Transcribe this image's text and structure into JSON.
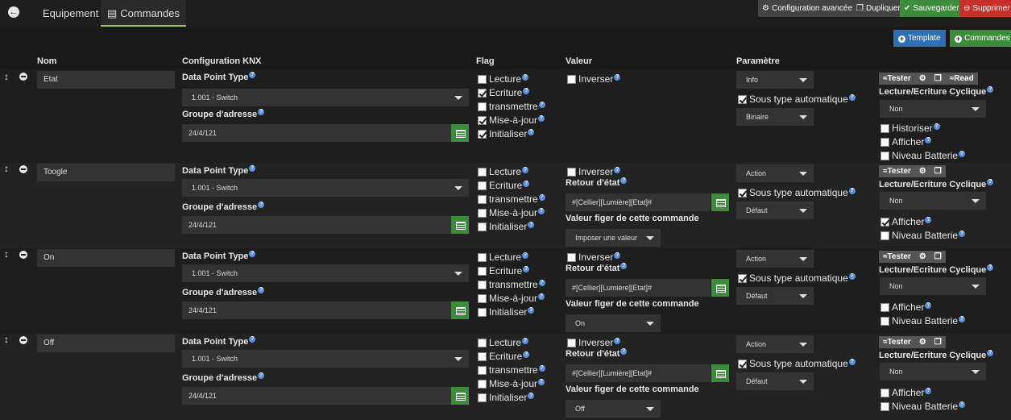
{
  "tabs": {
    "equipement": "Equipement",
    "commandes": "Commandes"
  },
  "toolbar": {
    "config": "Configuration avancée",
    "dupliquer": "Dupliquer",
    "sauvegarder": "Sauvegarder",
    "supprimer": "Supprimer"
  },
  "actions": {
    "template": "Template",
    "commandes": "Commandes"
  },
  "headers": {
    "nom": "Nom",
    "config": "Configuration KNX",
    "flag": "Flag",
    "valeur": "Valeur",
    "parametre": "Paramètre"
  },
  "labels": {
    "dpt": "Data Point Type",
    "groupe": "Groupe d'adresse",
    "lecture": "Lecture",
    "ecriture": "Ecriture",
    "transmettre": "transmettre",
    "miseajour": "Mise-à-jour",
    "initialiser": "Initialiser",
    "inverser": "Inverser",
    "retour": "Retour d'état",
    "figer": "Valeur figer de cette commande",
    "soustype": "Sous type automatique",
    "cyclique": "Lecture/Ecriture Cyclique",
    "historiser": "Historiser",
    "afficher": "Afficher",
    "batterie": "Niveau Batterie",
    "tester": "Tester",
    "read": "Read"
  },
  "rows": [
    {
      "name": "Etat",
      "dpt": "1.001 - Switch",
      "groupe": "24/4/121",
      "type": "Info",
      "subtype": "Binaire",
      "cyclique": "Non"
    },
    {
      "name": "Toogle",
      "dpt": "1.001 - Switch",
      "groupe": "24/4/121",
      "retour": "#[Cellier][Lumière][Etat]#",
      "figer": "Imposer une valeur",
      "type": "Action",
      "subtype": "Défaut",
      "cyclique": "Non"
    },
    {
      "name": "On",
      "dpt": "1.001 - Switch",
      "groupe": "24/4/121",
      "retour": "#[Cellier][Lumière][Etat]#",
      "figer": "On",
      "type": "Action",
      "subtype": "Défaut",
      "cyclique": "Non"
    },
    {
      "name": "Off",
      "dpt": "1.001 - Switch",
      "groupe": "24/4/121",
      "retour": "#[Cellier][Lumière][Etat]#",
      "figer": "Off",
      "type": "Action",
      "subtype": "Défaut",
      "cyclique": "Non"
    }
  ],
  "colors": {
    "config": "#444444",
    "dupliquer": "#444444",
    "sauvegarder": "#3c8c3c",
    "supprimer": "#c9302c",
    "template": "#2f6fb5",
    "commandes": "#3c8c3c"
  }
}
